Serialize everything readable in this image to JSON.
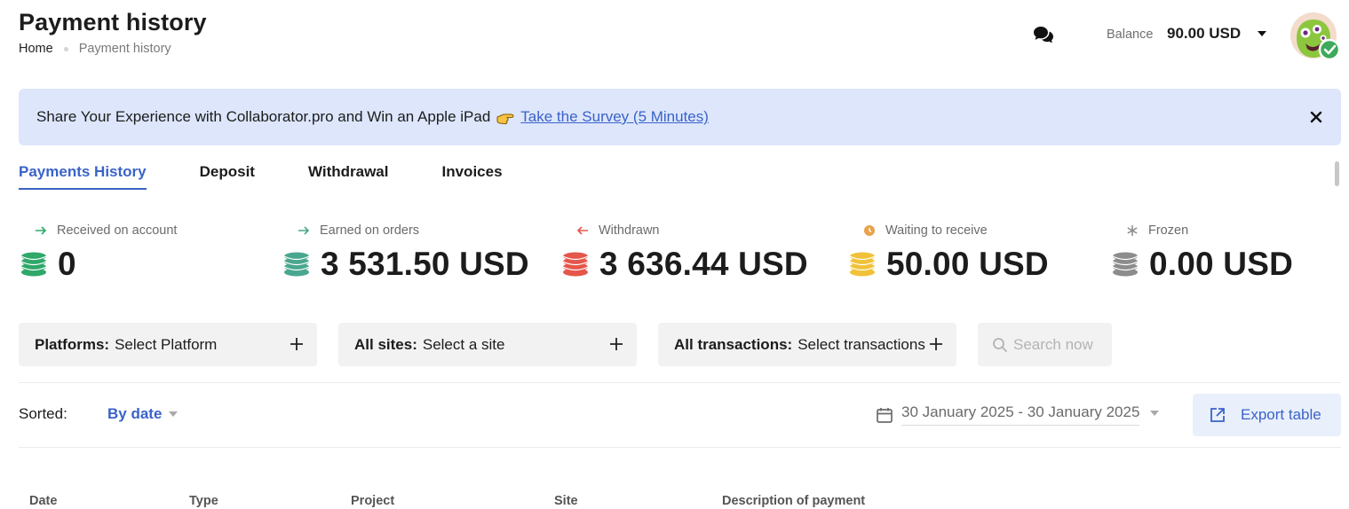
{
  "header": {
    "title": "Payment history",
    "breadcrumb": {
      "home": "Home",
      "current": "Payment history"
    },
    "balance_label": "Balance",
    "balance_value": "90.00 USD"
  },
  "banner": {
    "text": "Share Your Experience with Collaborator.pro and Win an Apple iPad",
    "link": "Take the Survey (5 Minutes)",
    "bg_color": "#dde6fb"
  },
  "tabs": [
    {
      "label": "Payments History",
      "active": true
    },
    {
      "label": "Deposit",
      "active": false
    },
    {
      "label": "Withdrawal",
      "active": false
    },
    {
      "label": "Invoices",
      "active": false
    }
  ],
  "stats": [
    {
      "label": "Received on account",
      "value": "0",
      "mini_icon": "arrow-right-icon",
      "color": "#2fa86a"
    },
    {
      "label": "Earned on orders",
      "value": "3 531.50 USD",
      "mini_icon": "arrow-right-icon",
      "color": "#4aa78f"
    },
    {
      "label": "Withdrawn",
      "value": "3 636.44 USD",
      "mini_icon": "arrow-left-icon",
      "color": "#e5564b"
    },
    {
      "label": "Waiting to receive",
      "value": "50.00 USD",
      "mini_icon": "clock-icon",
      "color": "#f0c23a"
    },
    {
      "label": "Frozen",
      "value": "0.00 USD",
      "mini_icon": "snowflake-icon",
      "color": "#8c8c8c"
    }
  ],
  "filters": {
    "platform": {
      "label": "Platforms:",
      "value": "Select Platform"
    },
    "sites": {
      "label": "All sites:",
      "value": "Select a site"
    },
    "transactions": {
      "label": "All transactions:",
      "value": "Select transactions"
    },
    "search_label": "Search now"
  },
  "sort": {
    "label": "Sorted:",
    "value": "By date"
  },
  "date_range": "30 January 2025 - 30 January 2025",
  "export_label": "Export table",
  "table": {
    "columns": [
      "Date",
      "Type",
      "Project",
      "Site",
      "Description of payment"
    ]
  },
  "colors": {
    "accent": "#3a63c9",
    "text": "#1c1c1c",
    "muted": "#6b6b6b"
  }
}
